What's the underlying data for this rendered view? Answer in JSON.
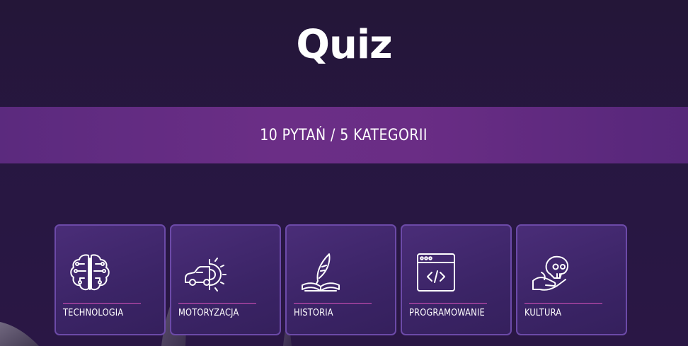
{
  "page": {
    "title": "Quiz",
    "banner": "10 PYTAŃ / 5 KATEGORII"
  },
  "categories": [
    {
      "label": "TECHNOLOGIA",
      "icon": "brain-circuit-icon"
    },
    {
      "label": "MOTORYZACJA",
      "icon": "car-gear-icon"
    },
    {
      "label": "HISTORIA",
      "icon": "quill-book-icon"
    },
    {
      "label": "PROGRAMOWANIE",
      "icon": "code-window-icon"
    },
    {
      "label": "KULTURA",
      "icon": "hand-skull-icon"
    }
  ],
  "colors": {
    "background": "#261640",
    "banner": "#6a2d85",
    "card": "#3f2669",
    "card_border": "#6c4aa8",
    "accent_line": "#d14fb8",
    "text": "#ffffff"
  }
}
